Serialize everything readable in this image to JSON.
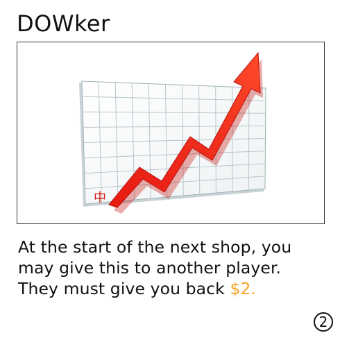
{
  "card": {
    "title": "DOWker",
    "text_lines": [
      "At the start of the next shop, you",
      "may give this to another player.",
      "They must give you back "
    ],
    "price_text": "$2.",
    "cost": "2"
  },
  "art": {
    "icon": "rising-stock-chart-illustration",
    "corner_glyph": "中"
  },
  "colors": {
    "price": "#f5a623",
    "arrow": "#e8201a",
    "grid": "#b8c6cc"
  }
}
